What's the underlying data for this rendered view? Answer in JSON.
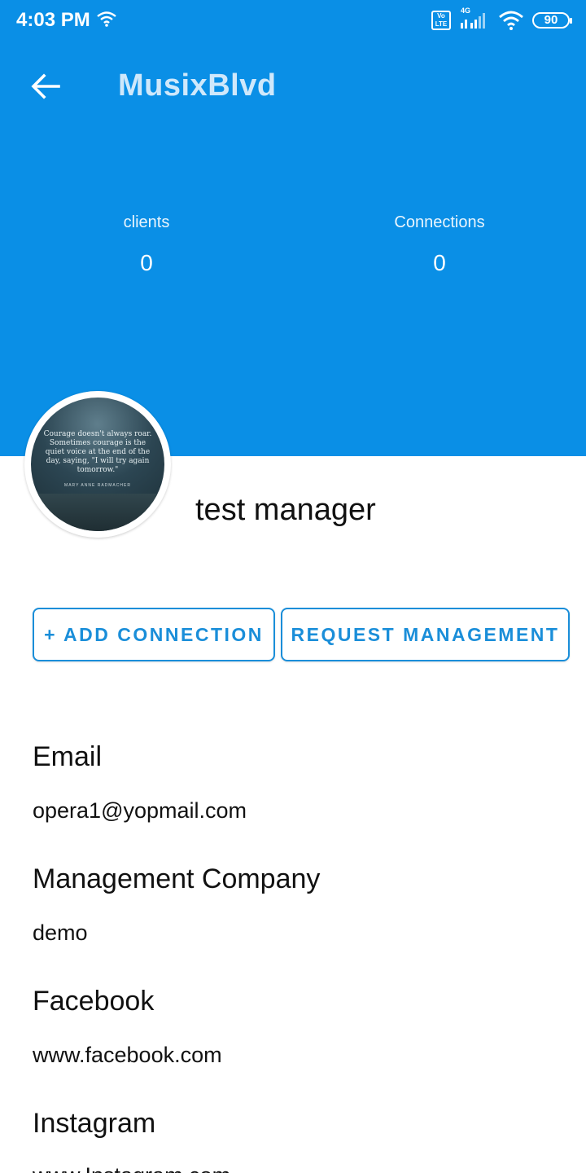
{
  "status_bar": {
    "time": "4:03 PM",
    "volte_label": "Vo LTE",
    "network_label": "4G",
    "battery": "90"
  },
  "toolbar": {
    "title": "MusixBlvd"
  },
  "stats": {
    "clients_label": "clients",
    "clients_value": "0",
    "connections_label": "Connections",
    "connections_value": "0"
  },
  "profile": {
    "name": "test manager",
    "avatar_quote": "Courage doesn't always roar. Sometimes courage is the quiet voice at the end of the day, saying, \"I will try again tomorrow.\"",
    "avatar_author": "MARY ANNE RADMACHER"
  },
  "actions": {
    "add_connection": "+ ADD CONNECTION",
    "request_management": "REQUEST MANAGEMENT"
  },
  "details": {
    "email_label": "Email",
    "email_value": "opera1@yopmail.com",
    "company_label": "Management Company",
    "company_value": "demo",
    "facebook_label": "Facebook",
    "facebook_value": "www.facebook.com",
    "instagram_label": "Instagram",
    "instagram_value": "www.Instagram.com"
  },
  "colors": {
    "header_blue": "#0a8fe6",
    "accent_blue": "#1a8ed9"
  }
}
